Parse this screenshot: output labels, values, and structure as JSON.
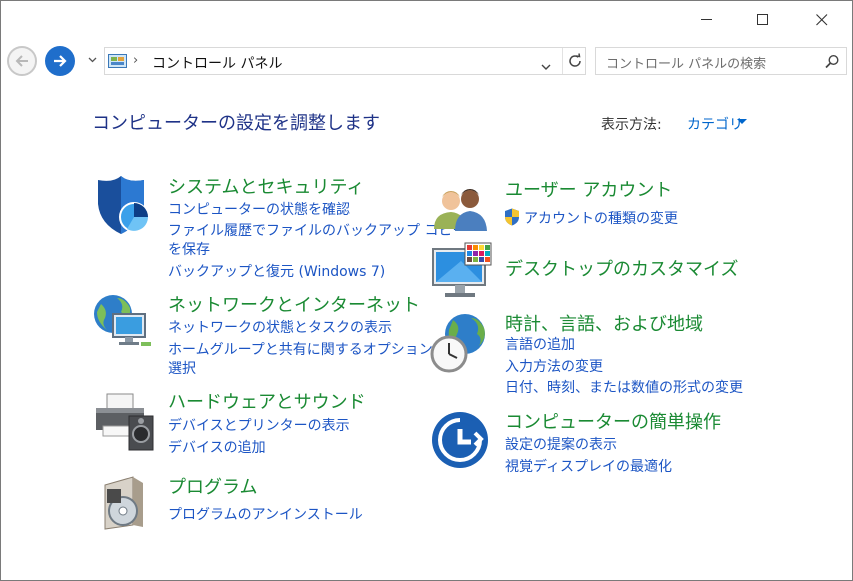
{
  "window": {
    "controls": [
      "minimize",
      "maximize",
      "close"
    ]
  },
  "address_bar": {
    "icon": "control-panel-icon",
    "separator": "›",
    "path": "コントロール パネル"
  },
  "search": {
    "placeholder": "コントロール パネルの検索"
  },
  "header": {
    "title": "コンピューターの設定を調整します",
    "view_by_label": "表示方法:",
    "view_by_value": "カテゴリ"
  },
  "categories": [
    {
      "icon": "shield-icon",
      "title": "システムとセキュリティ",
      "links": [
        "コンピューターの状態を確認",
        "ファイル履歴でファイルのバックアップ コピー",
        "を保存",
        "バックアップと復元 (Windows 7)"
      ]
    },
    {
      "icon": "network-icon",
      "title": "ネットワークとインターネット",
      "links": [
        "ネットワークの状態とタスクの表示",
        "ホームグループと共有に関するオプションの",
        "選択"
      ]
    },
    {
      "icon": "printer-speaker-icon",
      "title": "ハードウェアとサウンド",
      "links": [
        "デバイスとプリンターの表示",
        "デバイスの追加"
      ]
    },
    {
      "icon": "program-box-icon",
      "title": "プログラム",
      "links": [
        "プログラムのアンインストール"
      ]
    },
    {
      "icon": "users-icon",
      "title": "ユーザー アカウント",
      "links": [
        "アカウントの種類の変更"
      ]
    },
    {
      "icon": "monitor-palette-icon",
      "title": "デスクトップのカスタマイズ",
      "links": []
    },
    {
      "icon": "globe-clock-icon",
      "title": "時計、言語、および地域",
      "links": [
        "言語の追加",
        "入力方法の変更",
        "日付、時刻、または数値の形式の変更"
      ]
    },
    {
      "icon": "ease-of-access-icon",
      "title": "コンピューターの簡単操作",
      "links": [
        "設定の提案の表示",
        "視覚ディスプレイの最適化"
      ]
    }
  ],
  "colors": {
    "title_blue": "#1e3287",
    "category_green": "#1a8a33",
    "link_blue": "#1c55c4",
    "accent_blue": "#1f6ecb"
  }
}
